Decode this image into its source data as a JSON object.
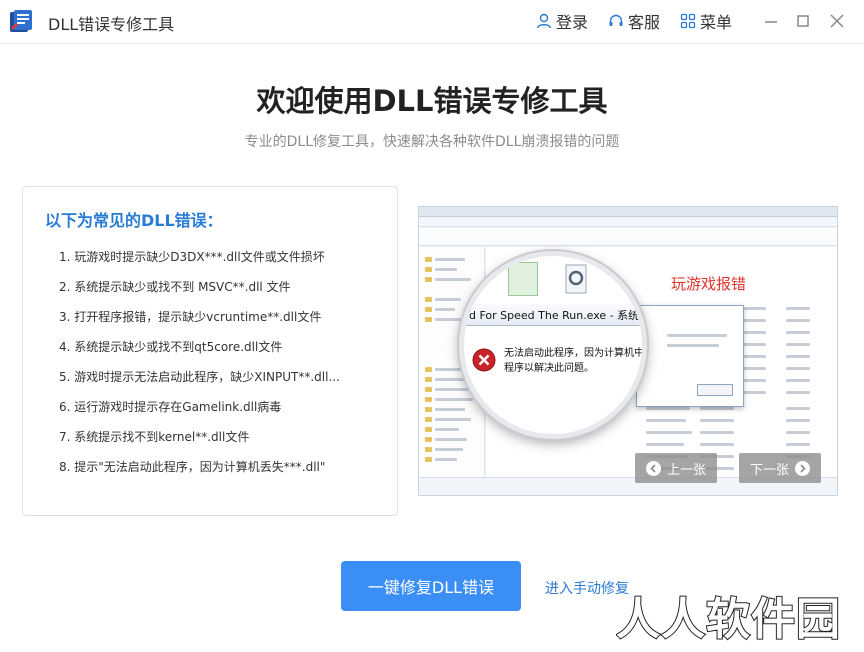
{
  "titlebar": {
    "app_title": "DLL错误专修工具",
    "login_label": "登录",
    "service_label": "客服",
    "menu_label": "菜单"
  },
  "hero": {
    "title": "欢迎使用DLL错误专修工具",
    "subtitle": "专业的DLL修复工具，快速解决各种软件DLL崩溃报错的问题"
  },
  "errors_panel": {
    "title": "以下为常见的DLL错误：",
    "items": [
      "1. 玩游戏时提示缺少D3DX***.dll文件或文件损坏",
      "2. 系统提示缺少或找不到 MSVC**.dll 文件",
      "3. 打开程序报错，提示缺少vcruntime**.dll文件",
      "4. 系统提示缺少或找不到qt5core.dll文件",
      "5. 游戏时提示无法启动此程序，缺少XINPUT**.dll...",
      "6. 运行游戏时提示存在Gamelink.dll病毒",
      "7. 系统提示找不到kernel**.dll文件",
      "8. 提示\"无法启动此程序，因为计算机丢失***.dll\""
    ]
  },
  "preview": {
    "label": "玩游戏报错",
    "dialog_caption": "d For Speed The Run.exe - 系统错误",
    "dialog_message": "无法启动此程序，因为计算机中丢失程序以解决此问题。",
    "prev_label": "上一张",
    "next_label": "下一张"
  },
  "actions": {
    "primary_label": "一键修复DLL错误",
    "manual_label": "进入手动修复"
  },
  "watermark": {
    "text": "人人软件园"
  },
  "colors": {
    "accent": "#3a8ef6",
    "panel_title": "#2a7bd5",
    "preview_label": "#e0332c",
    "error_icon": "#c9242a"
  }
}
